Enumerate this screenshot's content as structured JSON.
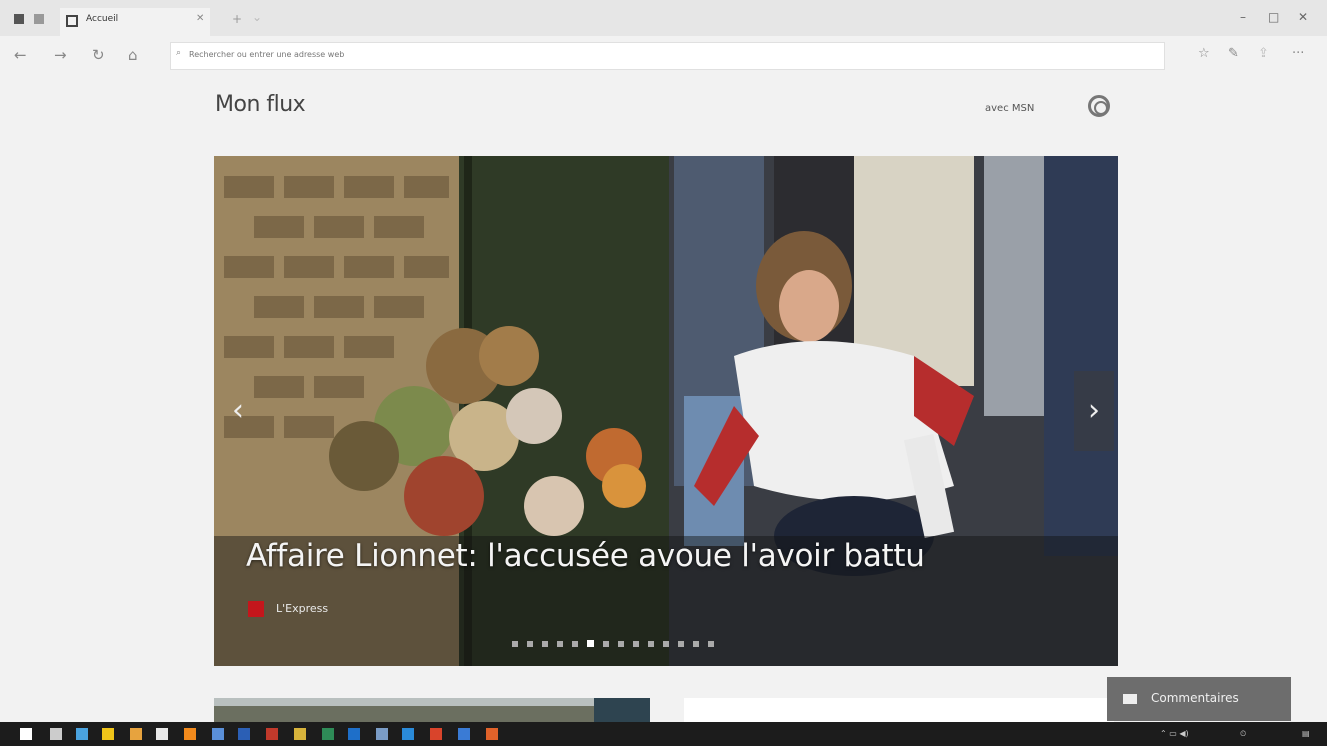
{
  "browser": {
    "tab_title": "Accueil",
    "address_placeholder": "Rechercher ou entrer une adresse web"
  },
  "page": {
    "title": "Mon flux",
    "msn_link": "avec MSN"
  },
  "hero": {
    "headline": "Affaire Lionnet: l'accusée avoue l'avoir battu",
    "source": "L'Express",
    "slide_count": 14,
    "active_slide": 5
  },
  "feedback_label": "Commentaires",
  "colors": {
    "source_logo": "#c4161c",
    "taskbar": "#1c1c1c"
  },
  "taskbar_icons": [
    "windows-start-icon",
    "search-icon",
    "task-view-icon",
    "file-explorer-icon",
    "store-icon",
    "mail-icon",
    "vlc-icon",
    "photos-icon",
    "word-icon",
    "filezilla-icon",
    "chrome-icon",
    "excel-icon",
    "outlook-icon",
    "notes-icon",
    "edge-icon",
    "office-icon",
    "calculator-icon",
    "paint-icon"
  ]
}
